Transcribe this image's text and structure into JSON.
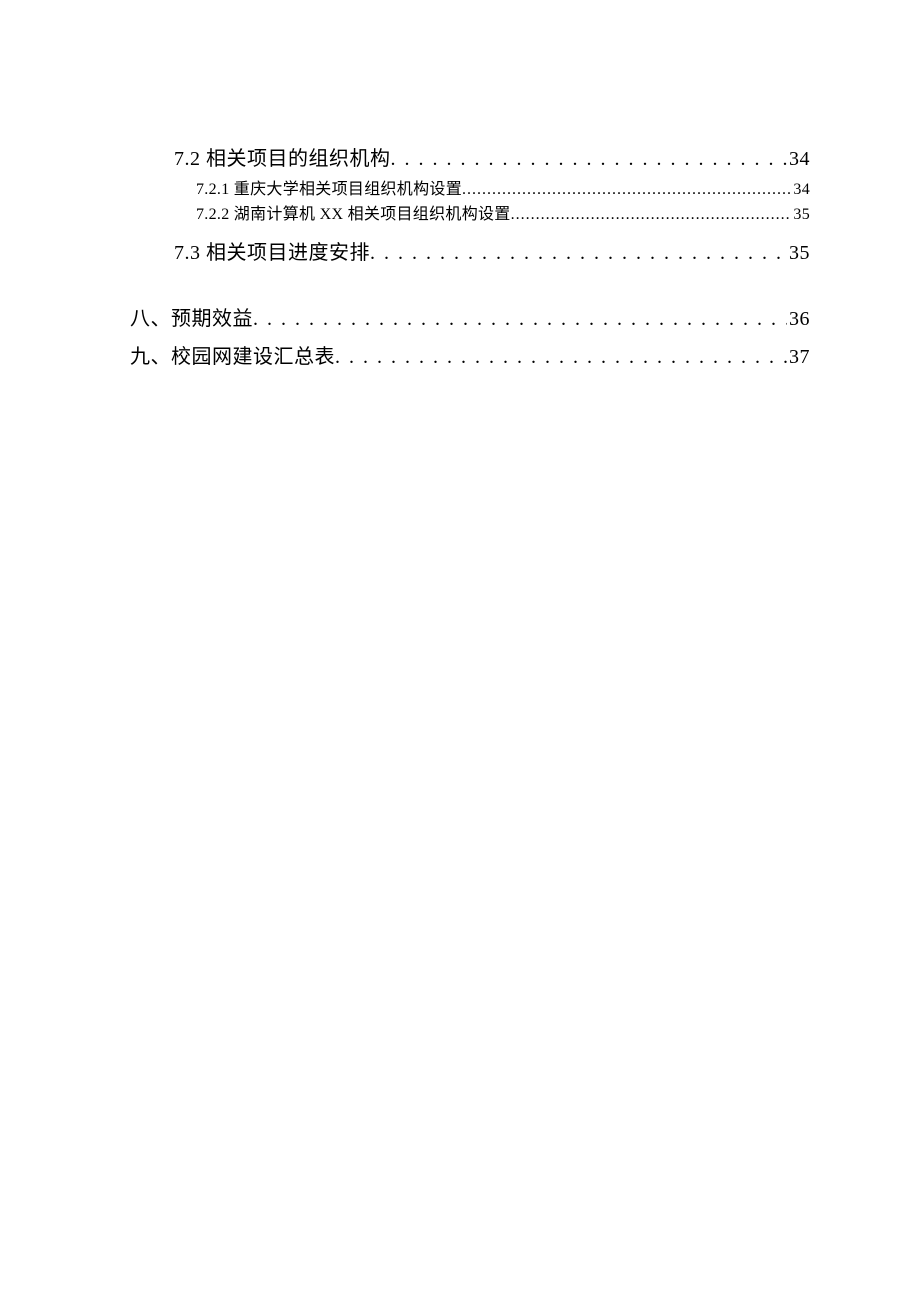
{
  "toc": [
    {
      "level": "lvl2",
      "label": "7.2 相关项目的组织机构 ",
      "page": " 34",
      "gap": ""
    },
    {
      "level": "lvl3",
      "label": "7.2.1 重庆大学相关项目组织机构设置 ",
      "page": " 34",
      "gap": ""
    },
    {
      "level": "lvl3",
      "label": "7.2.2 湖南计算机 XX 相关项目组织机构设置 ",
      "page": " 35",
      "gap": ""
    },
    {
      "level": "lvl2",
      "label": "7.3 相关项目进度安排 ",
      "page": " 35",
      "gap": "gap-before-lvl2"
    },
    {
      "level": "lvl1",
      "label": "八、预期效益 ",
      "page": " 36",
      "gap": "gap-before-lvl1"
    },
    {
      "level": "lvl1",
      "label": "九、校园网建设汇总表",
      "page": " 37",
      "gap": ""
    }
  ]
}
